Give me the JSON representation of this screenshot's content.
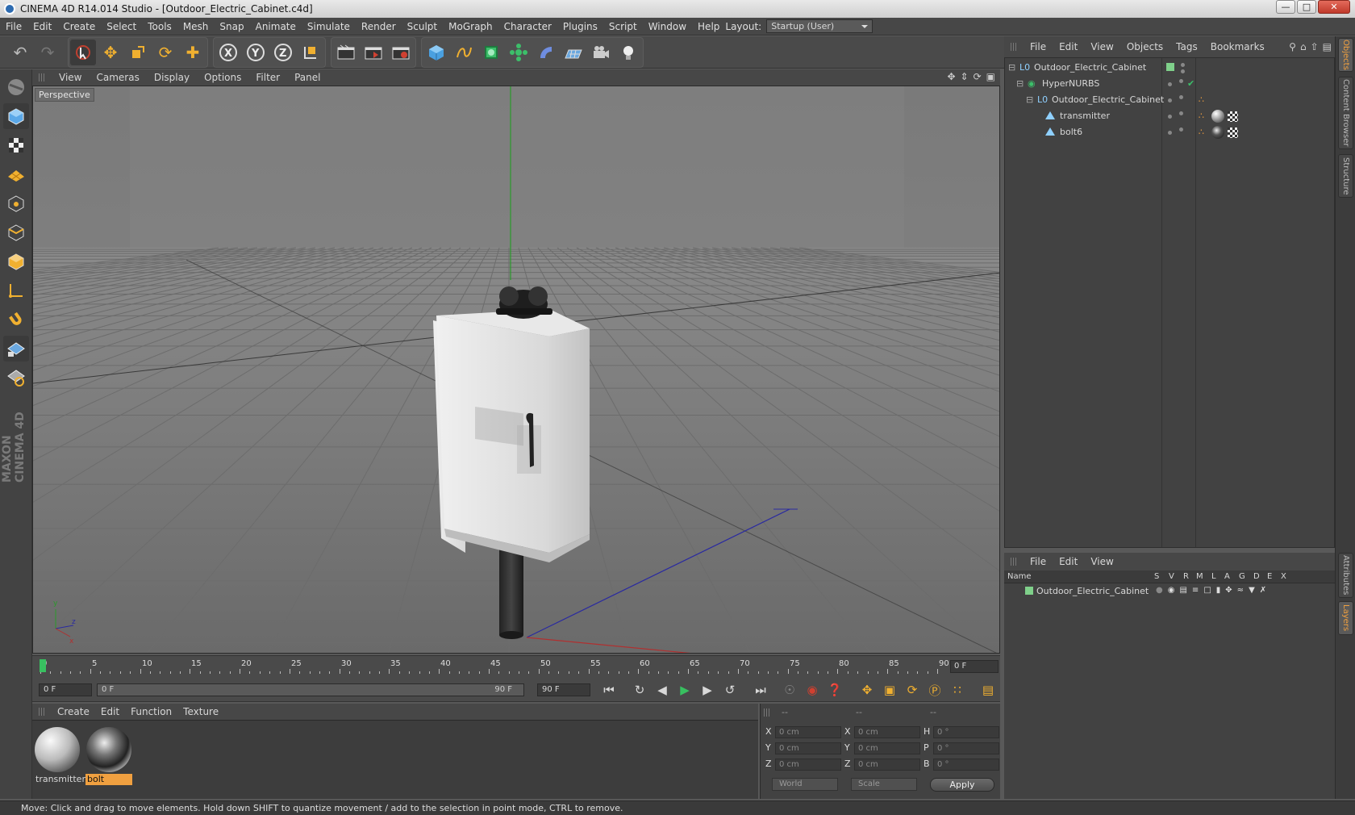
{
  "window": {
    "title": "CINEMA 4D R14.014 Studio - [Outdoor_Electric_Cabinet.c4d]",
    "controls": [
      "minimize",
      "maximize",
      "close"
    ]
  },
  "menubar": {
    "items": [
      "File",
      "Edit",
      "Create",
      "Select",
      "Tools",
      "Mesh",
      "Snap",
      "Animate",
      "Simulate",
      "Render",
      "Sculpt",
      "MoGraph",
      "Character",
      "Plugins",
      "Script",
      "Window",
      "Help"
    ],
    "layout_label": "Layout:",
    "layout_value": "Startup (User)"
  },
  "viewport": {
    "menu": [
      "View",
      "Cameras",
      "Display",
      "Options",
      "Filter",
      "Panel"
    ],
    "label": "Perspective"
  },
  "timeline": {
    "ticks": [
      "0",
      "5",
      "10",
      "15",
      "20",
      "25",
      "30",
      "35",
      "40",
      "45",
      "50",
      "55",
      "60",
      "65",
      "70",
      "75",
      "80",
      "85",
      "90"
    ],
    "current_frame": "0 F",
    "start_field": "0 F",
    "range_start": "0 F",
    "range_end": "90 F",
    "end_field": "90 F"
  },
  "material_manager": {
    "menu": [
      "Create",
      "Edit",
      "Function",
      "Texture"
    ],
    "materials": [
      {
        "name": "transmitter",
        "selected": false
      },
      {
        "name": "bolt",
        "selected": true
      }
    ]
  },
  "coordinates": {
    "headers": [
      "--",
      "--",
      "--"
    ],
    "rows": [
      {
        "l1": "X",
        "v1": "0 cm",
        "l2": "X",
        "v2": "0 cm",
        "l3": "H",
        "v3": "0 °"
      },
      {
        "l1": "Y",
        "v1": "0 cm",
        "l2": "Y",
        "v2": "0 cm",
        "l3": "P",
        "v3": "0 °"
      },
      {
        "l1": "Z",
        "v1": "0 cm",
        "l2": "Z",
        "v2": "0 cm",
        "l3": "B",
        "v3": "0 °"
      }
    ],
    "mode1": "World",
    "mode2": "Scale",
    "apply_label": "Apply"
  },
  "object_manager": {
    "menu": [
      "File",
      "Edit",
      "View",
      "Objects",
      "Tags",
      "Bookmarks"
    ],
    "objects": [
      {
        "name": "Outdoor_Electric_Cabinet",
        "icon": "null-object-icon"
      },
      {
        "name": "HyperNURBS",
        "icon": "hypernurbs-icon"
      },
      {
        "name": "Outdoor_Electric_Cabinet",
        "icon": "null-object-icon"
      },
      {
        "name": "transmitter",
        "icon": "polygon-object-icon"
      },
      {
        "name": "bolt6",
        "icon": "polygon-object-icon"
      }
    ]
  },
  "layer_manager": {
    "menu": [
      "File",
      "Edit",
      "View"
    ],
    "columns": [
      "Name",
      "S",
      "V",
      "R",
      "M",
      "L",
      "A",
      "G",
      "D",
      "E",
      "X"
    ],
    "layers": [
      {
        "name": "Outdoor_Electric_Cabinet",
        "color": "#7fd08a"
      }
    ]
  },
  "right_tabs": [
    "Objects",
    "Content Browser",
    "Structure",
    "Attributes",
    "Layers"
  ],
  "status": "Move: Click and drag to move elements. Hold down SHIFT to quantize movement / add to the selection in point mode, CTRL to remove.",
  "brand": "MAXON CINEMA 4D",
  "colors": {
    "accent": "#f0a040",
    "active_frame": "#38c060",
    "layer_green": "#7fd08a"
  }
}
